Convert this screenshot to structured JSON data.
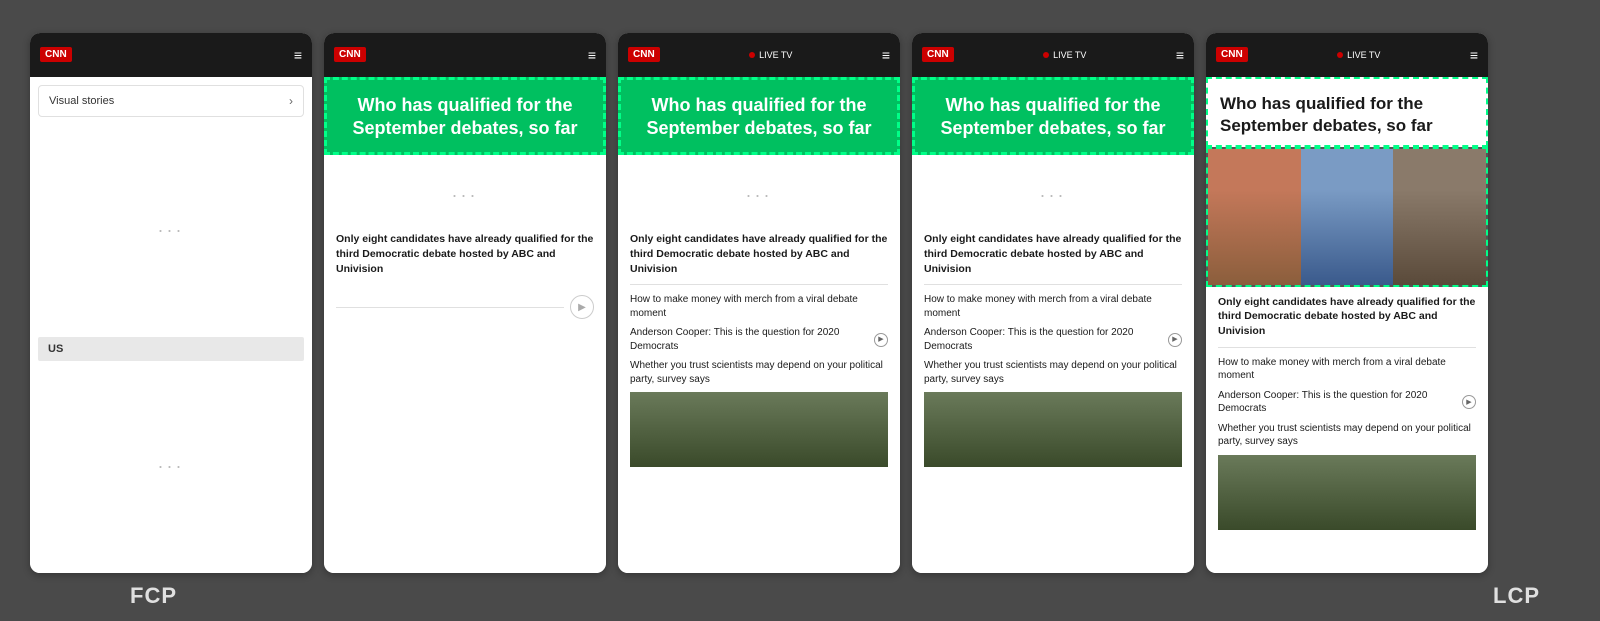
{
  "background": "#4a4a4a",
  "label_fcp": "FCP",
  "label_lcp": "LCP",
  "header": {
    "logo": "CNN",
    "hamburger": "≡",
    "live_tv": "LIVE TV"
  },
  "phone1": {
    "visual_stories_label": "Visual stories",
    "chevron": "›",
    "us_label": "US",
    "placeholder_dots": "···"
  },
  "article": {
    "title": "Who has qualified for the September debates, so far",
    "main_text": "Only eight candidates have already qualified for the third Democratic debate hosted by ABC and Univision",
    "sub1": "How to make money with merch from a viral debate moment",
    "sub2_prefix": "Anderson Cooper: This is the question for 2020 Democrats",
    "sub3": "Whether you trust scientists may depend on your political party, survey says"
  }
}
